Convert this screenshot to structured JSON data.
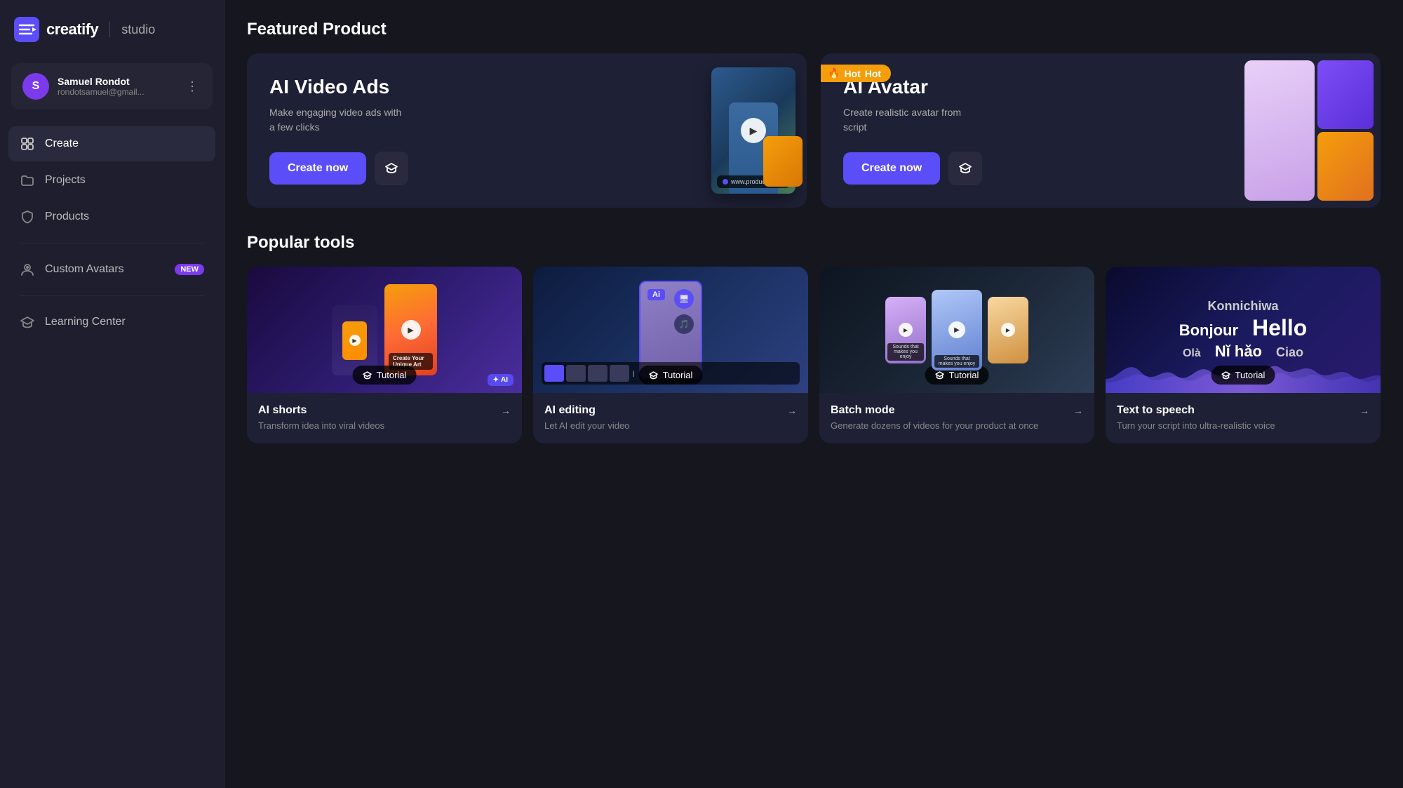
{
  "app": {
    "name": "creatify",
    "sub": "studio",
    "logo_icon": "≡>"
  },
  "user": {
    "name": "Samuel Rondot",
    "email": "rondotsamuel@gmail...",
    "initial": "S"
  },
  "sidebar": {
    "items": [
      {
        "id": "create",
        "label": "Create",
        "active": true
      },
      {
        "id": "projects",
        "label": "Projects",
        "active": false
      },
      {
        "id": "products",
        "label": "Products",
        "active": false
      },
      {
        "id": "custom-avatars",
        "label": "Custom Avatars",
        "active": false,
        "badge": "NEW"
      },
      {
        "id": "learning-center",
        "label": "Learning Center",
        "active": false
      }
    ]
  },
  "featured": {
    "title": "Featured Product",
    "cards": [
      {
        "id": "ai-video-ads",
        "badge": "Hot",
        "title": "AI Video Ads",
        "description": "Make engaging video ads with a few clicks",
        "cta": "Create now"
      },
      {
        "id": "ai-avatar",
        "title": "AI Avatar",
        "description": "Create realistic avatar from script",
        "cta": "Create now"
      }
    ]
  },
  "popular": {
    "title": "Popular tools",
    "tools": [
      {
        "id": "ai-shorts",
        "title": "AI shorts",
        "description": "Transform idea into viral videos",
        "tutorial": "Tutorial"
      },
      {
        "id": "ai-editing",
        "title": "AI editing",
        "description": "Let AI edit your video",
        "tutorial": "Tutorial"
      },
      {
        "id": "batch-mode",
        "title": "Batch mode",
        "description": "Generate dozens of videos for your product at once",
        "tutorial": "Tutorial"
      },
      {
        "id": "text-to-speech",
        "title": "Text to speech",
        "description": "Turn your script into ultra-realistic voice",
        "tutorial": "Tutorial"
      }
    ]
  }
}
